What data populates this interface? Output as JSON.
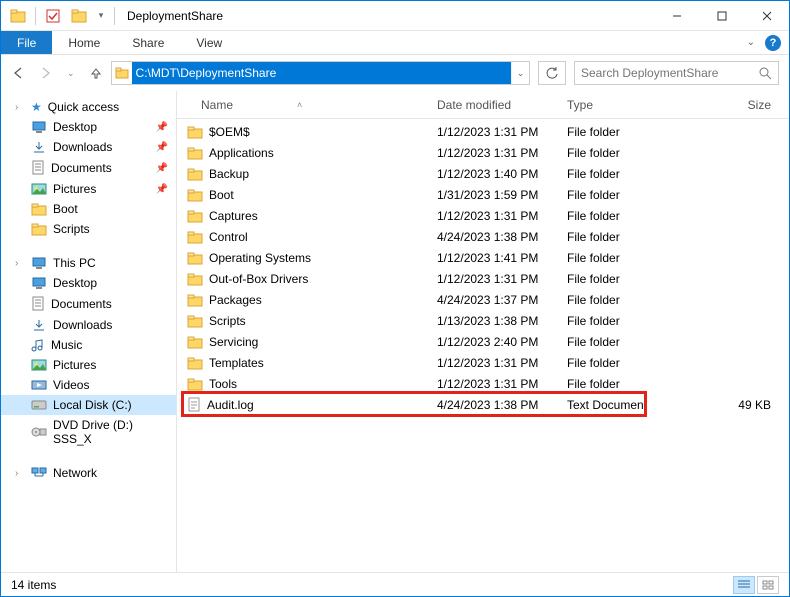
{
  "window": {
    "title": "DeploymentShare"
  },
  "tabs": {
    "file": "File",
    "home": "Home",
    "share": "Share",
    "view": "View"
  },
  "address": {
    "path": "C:\\MDT\\DeploymentShare"
  },
  "search": {
    "placeholder": "Search DeploymentShare"
  },
  "columns": {
    "name": "Name",
    "date": "Date modified",
    "type": "Type",
    "size": "Size"
  },
  "sidebar": {
    "quick": {
      "label": "Quick access",
      "items": [
        {
          "label": "Desktop",
          "pinned": true
        },
        {
          "label": "Downloads",
          "pinned": true
        },
        {
          "label": "Documents",
          "pinned": true
        },
        {
          "label": "Pictures",
          "pinned": true
        },
        {
          "label": "Boot",
          "pinned": false
        },
        {
          "label": "Scripts",
          "pinned": false
        }
      ]
    },
    "thispc": {
      "label": "This PC",
      "items": [
        {
          "label": "Desktop"
        },
        {
          "label": "Documents"
        },
        {
          "label": "Downloads"
        },
        {
          "label": "Music"
        },
        {
          "label": "Pictures"
        },
        {
          "label": "Videos"
        },
        {
          "label": "Local Disk (C:)",
          "selected": true
        },
        {
          "label": "DVD Drive (D:) SSS_X"
        }
      ]
    },
    "network": {
      "label": "Network"
    }
  },
  "files": [
    {
      "name": "$OEM$",
      "date": "1/12/2023 1:31 PM",
      "type": "File folder",
      "size": "",
      "icon": "folder"
    },
    {
      "name": "Applications",
      "date": "1/12/2023 1:31 PM",
      "type": "File folder",
      "size": "",
      "icon": "folder"
    },
    {
      "name": "Backup",
      "date": "1/12/2023 1:40 PM",
      "type": "File folder",
      "size": "",
      "icon": "folder"
    },
    {
      "name": "Boot",
      "date": "1/31/2023 1:59 PM",
      "type": "File folder",
      "size": "",
      "icon": "folder"
    },
    {
      "name": "Captures",
      "date": "1/12/2023 1:31 PM",
      "type": "File folder",
      "size": "",
      "icon": "folder"
    },
    {
      "name": "Control",
      "date": "4/24/2023 1:38 PM",
      "type": "File folder",
      "size": "",
      "icon": "folder"
    },
    {
      "name": "Operating Systems",
      "date": "1/12/2023 1:41 PM",
      "type": "File folder",
      "size": "",
      "icon": "folder"
    },
    {
      "name": "Out-of-Box Drivers",
      "date": "1/12/2023 1:31 PM",
      "type": "File folder",
      "size": "",
      "icon": "folder"
    },
    {
      "name": "Packages",
      "date": "4/24/2023 1:37 PM",
      "type": "File folder",
      "size": "",
      "icon": "folder"
    },
    {
      "name": "Scripts",
      "date": "1/13/2023 1:38 PM",
      "type": "File folder",
      "size": "",
      "icon": "folder"
    },
    {
      "name": "Servicing",
      "date": "1/12/2023 2:40 PM",
      "type": "File folder",
      "size": "",
      "icon": "folder"
    },
    {
      "name": "Templates",
      "date": "1/12/2023 1:31 PM",
      "type": "File folder",
      "size": "",
      "icon": "folder"
    },
    {
      "name": "Tools",
      "date": "1/12/2023 1:31 PM",
      "type": "File folder",
      "size": "",
      "icon": "folder"
    },
    {
      "name": "Audit.log",
      "date": "4/24/2023 1:38 PM",
      "type": "Text Document",
      "size": "49 KB",
      "icon": "txt",
      "highlight": true
    }
  ],
  "status": {
    "count": "14 items"
  }
}
